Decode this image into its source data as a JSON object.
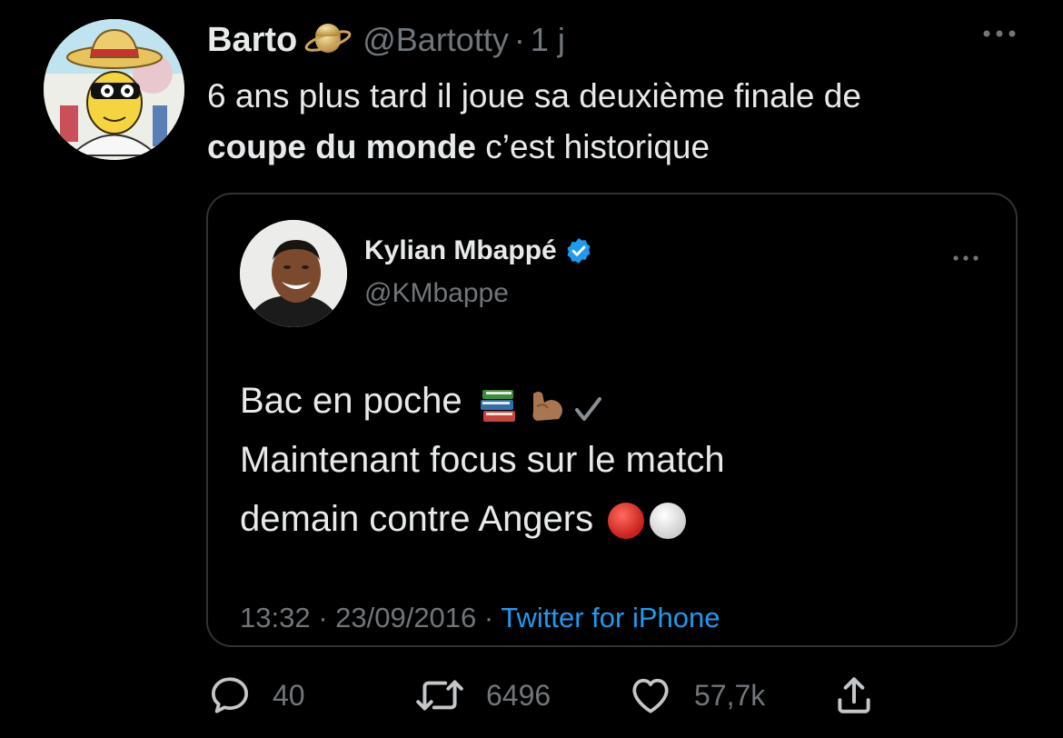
{
  "tweet": {
    "author": {
      "display_name": "Barto",
      "name_emoji": "planet-icon",
      "handle": "@Bartotty",
      "time_ago": "1 j"
    },
    "text_part1": "6 ans plus tard il joue sa deuxième finale de",
    "text_bold": "coupe du monde",
    "text_part2": "c’est historique"
  },
  "quote": {
    "author": {
      "display_name": "Kylian Mbappé",
      "verified": true,
      "handle": "@KMbappe"
    },
    "line1": "Bac en poche",
    "line1_emojis": [
      "books-icon",
      "flexed-biceps-icon",
      "check-mark-icon"
    ],
    "line2": "Maintenant focus sur le match",
    "line3": "demain contre Angers",
    "line3_emojis": [
      "red-circle-icon",
      "white-circle-icon"
    ],
    "timestamp": "13:32 · 23/09/2016 ·",
    "source": "Twitter for iPhone"
  },
  "actions": {
    "replies": "40",
    "retweets": "6496",
    "likes": "57,7k"
  },
  "colors": {
    "background": "#000000",
    "text": "#e7e9ea",
    "muted": "#71767b",
    "link": "#1d9bf0",
    "border": "#2f3336",
    "verified": "#1d9bf0"
  }
}
